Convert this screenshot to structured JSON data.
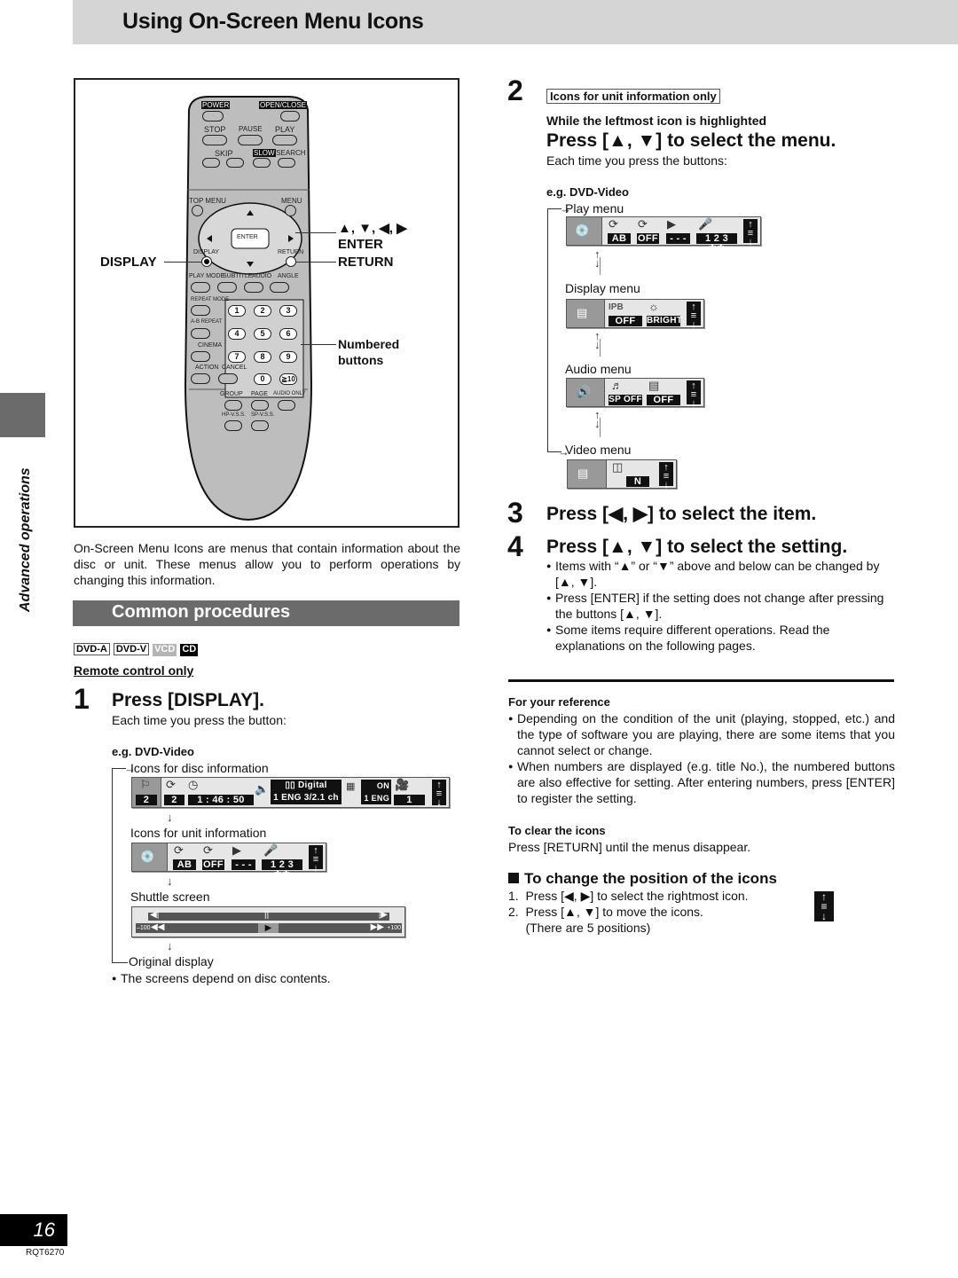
{
  "header": {
    "title": "Using On-Screen Menu Icons"
  },
  "sidebar": {
    "section_label": "Advanced operations"
  },
  "remote": {
    "labels": {
      "power": "POWER",
      "open_close": "OPEN/CLOSE",
      "stop": "STOP",
      "pause": "PAUSE",
      "play": "PLAY",
      "skip": "SKIP",
      "slow": "SLOW",
      "search": "/SEARCH",
      "top_menu": "TOP MENU",
      "menu": "MENU",
      "enter": "ENTER",
      "display": "DISPLAY",
      "return": "RETURN",
      "play_mode": "PLAY MODE",
      "subtitle": "SUBTITLE",
      "audio": "AUDIO",
      "angle": "ANGLE",
      "repeat_mode": "REPEAT MODE",
      "ab_repeat": "A-B REPEAT",
      "cinema": "CINEMA",
      "action": "ACTION",
      "cancel": "CANCEL",
      "group": "GROUP",
      "page": "PAGE",
      "audio_only": "AUDIO ONLY",
      "hp_vss": "HP-V.S.S.",
      "sp_vss": "SP-V.S.S."
    },
    "numbers": [
      "1",
      "2",
      "3",
      "4",
      "5",
      "6",
      "7",
      "8",
      "9",
      "0",
      "≧10"
    ],
    "callouts": {
      "arrows": "▲, ▼, ◀, ▶",
      "enter": "ENTER",
      "return": "RETURN",
      "display": "DISPLAY",
      "numbered_1": "Numbered",
      "numbered_2": "buttons"
    }
  },
  "intro": "On-Screen Menu Icons are menus that contain information about the disc or unit. These menus allow you to perform operations by changing this information.",
  "common": {
    "heading": "Common procedures",
    "badges": [
      "DVD-A",
      "DVD-V",
      "VCD",
      "CD"
    ],
    "remote_only": "Remote control only"
  },
  "step1": {
    "num": "1",
    "heading": "Press [DISPLAY].",
    "sub": "Each time you press the button:",
    "eg": "e.g. DVD-Video",
    "disc_info_label": "Icons for disc information",
    "disc_info": {
      "title": "2",
      "chapter": "2",
      "time": "1 : 46 : 50",
      "audio_top": "▯▯ Digital",
      "audio_bottom": "1 ENG  3/2.1 ch",
      "sub_on": "ON",
      "sub_lang": "1  ENG",
      "angle": "1"
    },
    "unit_info_label": "Icons for unit information",
    "unit_info": {
      "ab": "AB",
      "repeat": "OFF",
      "marker": "- - -",
      "karaoke": "1 2 3 ✱✱"
    },
    "shuttle_label": "Shuttle screen",
    "shuttle": {
      "min": "–100",
      "max": "+100"
    },
    "original_label": "Original display",
    "note": "The screens depend on disc contents."
  },
  "step2": {
    "num": "2",
    "tag": "Icons for unit information only",
    "condition": "While the leftmost icon is highlighted",
    "heading": "Press [▲, ▼] to select the menu.",
    "sub": "Each time you press the buttons:",
    "eg": "e.g. DVD-Video",
    "menus": [
      {
        "name": "Play menu",
        "values": [
          "AB",
          "OFF",
          "- - -",
          "1 2 3 ✱✱"
        ]
      },
      {
        "name": "Display menu",
        "values": [
          "OFF",
          "BRIGHT"
        ],
        "icon_text": "IPB"
      },
      {
        "name": "Audio menu",
        "values": [
          "SP OFF",
          "OFF"
        ]
      },
      {
        "name": "Video menu",
        "values": [
          "N"
        ]
      }
    ]
  },
  "step3": {
    "num": "3",
    "heading": "Press [◀, ▶] to select the item."
  },
  "step4": {
    "num": "4",
    "heading": "Press [▲, ▼] to select the setting.",
    "bullets": [
      "Items with “▲” or “▼” above and below can be changed by [▲, ▼].",
      "Press [ENTER] if the setting does not change after pressing the buttons [▲, ▼].",
      "Some items require different operations. Read the explanations on the following pages."
    ]
  },
  "reference": {
    "heading": "For your reference",
    "bullets": [
      "Depending on the condition of the unit (playing, stopped, etc.) and the type of software you are playing, there are some items that you cannot select or change.",
      "When numbers are displayed (e.g. title No.), the numbered buttons are also effective for setting. After entering numbers, press [ENTER] to register the setting."
    ]
  },
  "clear": {
    "heading": "To clear the icons",
    "text": "Press [RETURN] until the menus disappear."
  },
  "position": {
    "heading": "To change the position of the icons",
    "steps": [
      "1.  Press [◀, ▶] to select the rightmost icon.",
      "2.  Press [▲, ▼] to move the icons.",
      "     (There are 5 positions)"
    ]
  },
  "footer": {
    "page": "16",
    "model": "RQT6270"
  }
}
